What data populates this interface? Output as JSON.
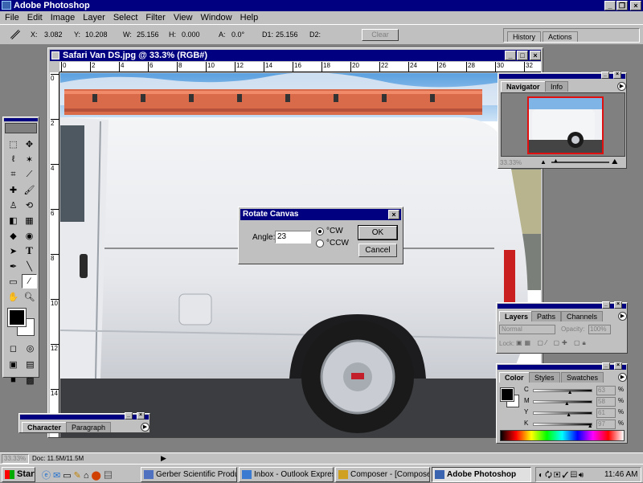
{
  "app": {
    "title": "Adobe Photoshop",
    "menu": [
      "File",
      "Edit",
      "Image",
      "Layer",
      "Select",
      "Filter",
      "View",
      "Window",
      "Help"
    ]
  },
  "options_bar": {
    "x_label": "X:",
    "x_value": "3.082",
    "y_label": "Y:",
    "y_value": "10.208",
    "w_label": "W:",
    "w_value": "25.156",
    "h_label": "H:",
    "h_value": "0.000",
    "a_label": "A:",
    "a_value": "0.0°",
    "d1_label": "D1:",
    "d1_value": "25.156",
    "d2_label": "D2:",
    "clear_label": "Clear",
    "palette_tabs": [
      "History",
      "Actions"
    ]
  },
  "document": {
    "title": "Safari Van DS.jpg @ 33.3% (RGB#)",
    "ruler_top": [
      "0",
      "2",
      "4",
      "6",
      "8",
      "10",
      "12",
      "14",
      "16",
      "18",
      "20",
      "22",
      "24",
      "26",
      "28",
      "30",
      "32"
    ],
    "ruler_left": [
      "0",
      "2",
      "4",
      "6",
      "8",
      "10",
      "12",
      "14"
    ],
    "zoom": "33.33%",
    "doc_info": "Doc: 11.5M/11.5M"
  },
  "dialog": {
    "title": "Rotate Canvas",
    "angle_label": "Angle:",
    "angle_value": "23",
    "cw_label": "°CW",
    "ccw_label": "°CCW",
    "ok_label": "OK",
    "cancel_label": "Cancel"
  },
  "navigator": {
    "tabs": [
      "Navigator",
      "Info"
    ],
    "zoom": "33.33%"
  },
  "layers": {
    "tabs": [
      "Layers",
      "Paths",
      "Channels"
    ],
    "blend_mode": "Normal",
    "opacity_label": "Opacity:",
    "opacity_value": "100%",
    "lock_label": "Lock:"
  },
  "color": {
    "tabs": [
      "Color",
      "Styles",
      "Swatches"
    ],
    "channels": [
      {
        "label": "C",
        "value": "63",
        "percent": 0.63
      },
      {
        "label": "M",
        "value": "58",
        "percent": 0.58
      },
      {
        "label": "Y",
        "value": "61",
        "percent": 0.61
      },
      {
        "label": "K",
        "value": "97",
        "percent": 0.97
      }
    ],
    "pct": "%"
  },
  "character": {
    "tabs": [
      "Character",
      "Paragraph"
    ]
  },
  "taskbar": {
    "start": "Start",
    "buttons": [
      {
        "label": "Gerber Scientific Product...",
        "pressed": false
      },
      {
        "label": "Inbox - Outlook Express",
        "pressed": false
      },
      {
        "label": "Composer - [Composer2 *]",
        "pressed": false
      },
      {
        "label": "Adobe Photoshop",
        "pressed": true
      }
    ],
    "clock": "11:46 AM"
  },
  "colors": {
    "titlebar": "#000080",
    "desktop": "#808080",
    "face": "#c0c0c0"
  }
}
